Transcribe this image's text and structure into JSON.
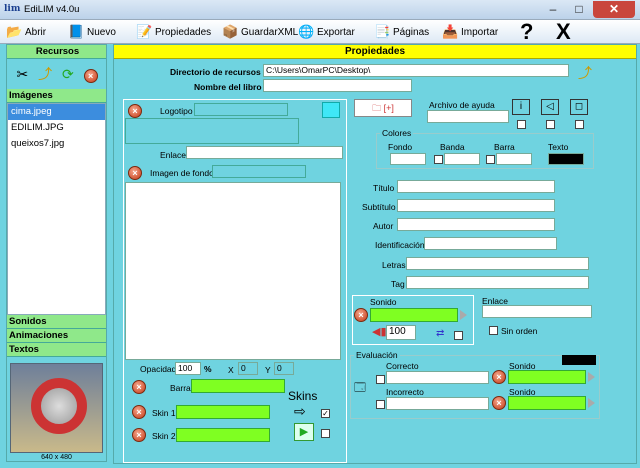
{
  "window": {
    "title": "EdiLIM  v4.0u",
    "app_icon": "lim",
    "minimize": "–",
    "maximize": "□",
    "close": "✕"
  },
  "toolbar": {
    "items": [
      {
        "label": "Abrir",
        "icon": "folder-open-icon",
        "glyph": "📂"
      },
      {
        "label": "Nuevo",
        "icon": "new-book-icon",
        "glyph": "📘"
      },
      {
        "label": "Propiedades",
        "icon": "properties-icon",
        "glyph": "📝"
      },
      {
        "label": "GuardarXML",
        "icon": "save-box-icon",
        "glyph": "📦"
      },
      {
        "label": "Exportar",
        "icon": "export-icon",
        "glyph": "🌐"
      },
      {
        "label": "Páginas",
        "icon": "pages-icon",
        "glyph": "📑"
      },
      {
        "label": "Importar",
        "icon": "import-icon",
        "glyph": "📥"
      }
    ],
    "help": "?",
    "close": "X"
  },
  "left": {
    "resources_header": "Recursos",
    "images_header": "Imágenes",
    "files": [
      "cima.jpeg",
      "EDILIM.JPG",
      "queixos7.jpg"
    ],
    "sounds_header": "Sonidos",
    "animations_header": "Animaciones",
    "texts_header": "Textos",
    "preview_caption": "640 x 480"
  },
  "main": {
    "header": "Propiedades",
    "dir_label": "Directorio de recursos",
    "dir_value": "C:\\Users\\OmarPC\\Desktop\\",
    "book_label": "Nombre del libro",
    "book_value": "",
    "logo_label": "Logotipo",
    "link_label": "Enlace",
    "bg_label": "Imagen de fondo",
    "opacity_label": "Opacidad",
    "opacity_value": "100",
    "percent": "%",
    "x_label": "X",
    "x_value": "0",
    "y_label": "Y",
    "y_value": "0",
    "bar_label": "Barra",
    "skin1_label": "Skin 1",
    "skin2_label": "Skin 2",
    "skins_label": "Skins",
    "add_button": "[+]",
    "help_file_label": "Archivo de ayuda",
    "colors_label": "Colores",
    "fondo_label": "Fondo",
    "banda_label": "Banda",
    "barra_label": "Barra",
    "texto_label": "Texto",
    "titulo_label": "Título",
    "subtitulo_label": "Subtítulo",
    "autor_label": "Autor",
    "ident_label": "Identificación",
    "letras_label": "Letras",
    "tag_label": "Tag",
    "sonido_label": "Sonido",
    "volume_value": "100",
    "enlace2_label": "Enlace",
    "sin_orden_label": "Sin orden",
    "eval_label": "Evaluación",
    "correcto_label": "Correcto",
    "incorrecto_label": "Incorrecto",
    "sonido_c_label": "Sonido",
    "sonido_i_label": "Sonido"
  },
  "colors": {
    "accent_green": "#7fff22",
    "header_yellow": "#ffff00",
    "panel_cyan": "#6fd3e0",
    "selected": "#3c8dde",
    "text_swatch": "#000000"
  }
}
